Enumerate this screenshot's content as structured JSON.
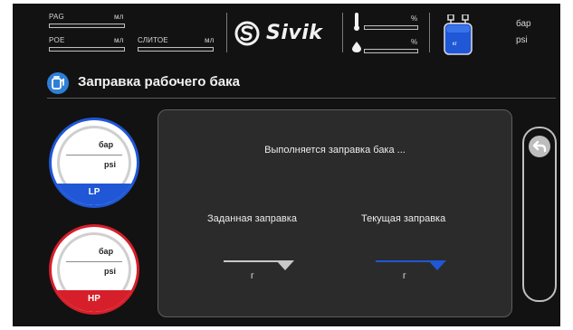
{
  "header": {
    "pag_label": "PAG",
    "pag_unit": "мл",
    "poe_label": "POE",
    "poe_unit": "мл",
    "drain_label": "СЛИТОЕ",
    "drain_unit": "мл",
    "logo_text": "Sivik",
    "temp_unit": "%",
    "humidity_unit": "%",
    "tank_label": "кг",
    "pressure_unit_bar": "бар",
    "pressure_unit_psi": "psi"
  },
  "section": {
    "title": "Заправка рабочего бака"
  },
  "gauges": {
    "lp": {
      "unit_bar": "бар",
      "unit_psi": "psi",
      "label": "LP"
    },
    "hp": {
      "unit_bar": "бар",
      "unit_psi": "psi",
      "label": "HP"
    }
  },
  "panel": {
    "status": "Выполняется заправка бака ...",
    "set_label": "Заданная заправка",
    "current_label": "Текущая заправка",
    "set_unit": "г",
    "current_unit": "г"
  },
  "colors": {
    "lp_blue": "#1f57d6",
    "hp_red": "#d61f2a",
    "accent_blue": "#2e7fd6",
    "panel_bg": "#2b2b2b",
    "screen_bg": "#121212"
  },
  "icons": {
    "title": "refill-tank-icon",
    "back": "back-arrow-icon",
    "tank": "tank-icon",
    "temperature": "thermometer-icon",
    "humidity": "droplet-icon",
    "logo": "sivik-logo-icon"
  }
}
